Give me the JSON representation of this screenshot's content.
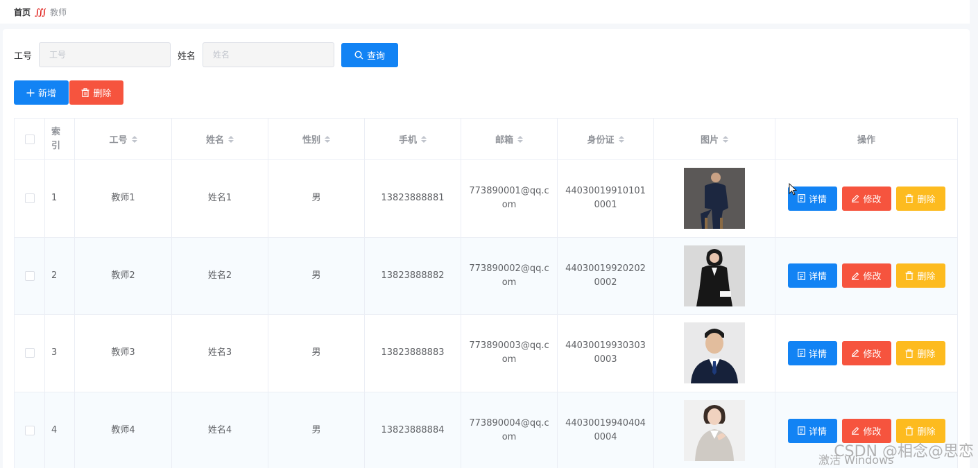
{
  "breadcrumb": {
    "home": "首页",
    "current": "教师"
  },
  "search": {
    "no_label": "工号",
    "no_placeholder": "工号",
    "name_label": "姓名",
    "name_placeholder": "姓名",
    "query_button": "查询"
  },
  "toolbar": {
    "add_button": "新增",
    "delete_button": "删除"
  },
  "table": {
    "headers": {
      "index": "索引",
      "no": "工号",
      "name": "姓名",
      "gender": "性别",
      "phone": "手机",
      "email": "邮箱",
      "idcard": "身份证",
      "picture": "图片",
      "operation": "操作"
    },
    "rows": [
      {
        "index": "1",
        "no": "教师1",
        "name": "姓名1",
        "gender": "男",
        "phone": "13823888881",
        "email": "773890001@qq.com",
        "idcard": "440300199101010001"
      },
      {
        "index": "2",
        "no": "教师2",
        "name": "姓名2",
        "gender": "男",
        "phone": "13823888882",
        "email": "773890002@qq.com",
        "idcard": "440300199202020002"
      },
      {
        "index": "3",
        "no": "教师3",
        "name": "姓名3",
        "gender": "男",
        "phone": "13823888883",
        "email": "773890003@qq.com",
        "idcard": "440300199303030003"
      },
      {
        "index": "4",
        "no": "教师4",
        "name": "姓名4",
        "gender": "男",
        "phone": "13823888884",
        "email": "773890004@qq.com",
        "idcard": "440300199404040004"
      }
    ],
    "actions": {
      "detail": "详情",
      "edit": "修改",
      "delete": "删除"
    }
  },
  "colors": {
    "primary": "#1283f4",
    "danger": "#f6543e",
    "warning": "#fdbb1f"
  },
  "overlay": {
    "watermark": "CSDN @相念@思恋",
    "activate": "激活 Windows"
  }
}
